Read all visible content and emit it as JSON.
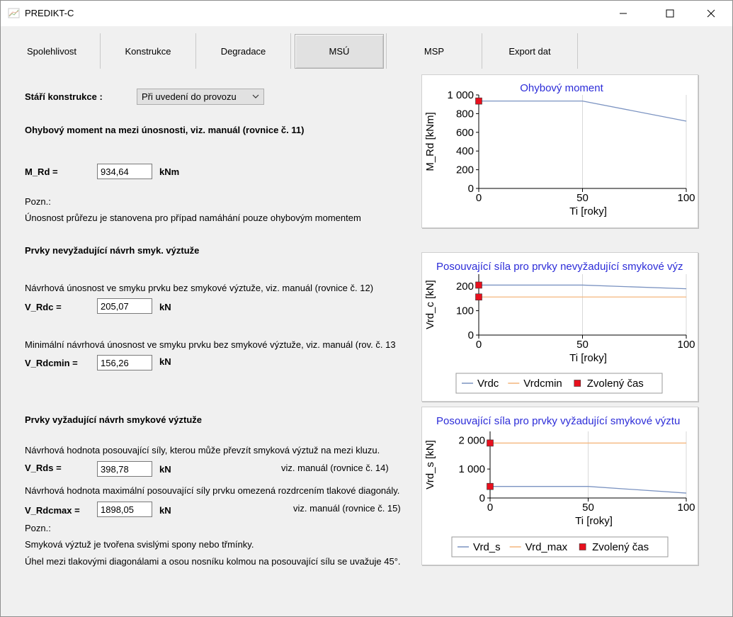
{
  "window": {
    "title": "PREDIKT-C",
    "minimize": "—",
    "maximize": "☐",
    "close": "✕"
  },
  "tabs": [
    "Spolehlivost",
    "Konstrukce",
    "Degradace",
    "MSÚ",
    "MSP",
    "Export dat"
  ],
  "active_tab": "MSÚ",
  "age": {
    "label": "Stáří konstrukce :",
    "value": "Při uvedení do provozu"
  },
  "bending": {
    "heading": "Ohybový moment na mezi únosnosti, viz. manuál (rovnice č. 11)",
    "m_rd_label": "M_Rd =",
    "m_rd_value": "934,64",
    "m_rd_unit": "kNm",
    "note_title": "Pozn.:",
    "note": "Únosnost průřezu je stanovena pro případ namáhání pouze ohybovým momentem"
  },
  "no_shear": {
    "heading": "Prvky nevyžadující návrh smyk. výztuže",
    "vrdc_desc": "Návrhová únosnost ve smyku prvku bez smykové výztuže, viz. manuál (rovnice č. 12)",
    "vrdc_label": "V_Rdc =",
    "vrdc_value": "205,07",
    "vrdc_unit": "kN",
    "vrdcmin_desc": "Minimální návrhová únosnost ve smyku prvku bez smykové výztuže, viz. manuál (rov. č. 13",
    "vrdcmin_label": "V_Rdcmin =",
    "vrdcmin_value": "156,26",
    "vrdcmin_unit": "kN"
  },
  "shear": {
    "heading": "Prvky vyžadující návrh smykové výztuže",
    "vrds_desc": "Návrhová hodnota posouvající síly, kterou může převzít smyková výztuž na mezi kluzu.",
    "vrds_label": "V_Rds =",
    "vrds_value": "398,78",
    "vrds_unit": "kN",
    "vrds_ref": "viz. manuál (rovnice č. 14)",
    "vrdmax_desc": "Návrhová hodnota maximální posouvající síly prvku omezená rozdrcením tlakové diagonály.",
    "vrdmax_label": "V_Rdcmax =",
    "vrdmax_value": "1898,05",
    "vrdmax_unit": "kN",
    "vrdmax_ref": "viz. manuál (rovnice č. 15)",
    "note_title": "Pozn.:",
    "note1": "Smyková výztuž je tvořena svislými spony nebo třmínky.",
    "note2": "Úhel mezi tlakovými diagonálami a osou nosníku kolmou na posouvající sílu se uvažuje 45°."
  },
  "colors": {
    "series_blue": "#7b93c1",
    "series_orange": "#f4b67d",
    "marker_red": "#e8101e",
    "title_blue": "#2c2cd8"
  },
  "chart_data": [
    {
      "type": "line",
      "title": "Ohybový moment",
      "xlabel": "Ti [roky]",
      "ylabel": "M_Rd [kNm]",
      "xlim": [
        0,
        100
      ],
      "ylim": [
        0,
        1000
      ],
      "xticks": [
        "0",
        "50",
        "100"
      ],
      "yticks": [
        "0",
        "200",
        "400",
        "600",
        "800",
        "1 000"
      ],
      "series": [
        {
          "name": "",
          "x": [
            0,
            50,
            100
          ],
          "y": [
            934.64,
            934.64,
            720
          ]
        }
      ],
      "markers": [
        {
          "x": 0,
          "y": 934.64
        }
      ],
      "legend": []
    },
    {
      "type": "line",
      "title": "Posouvající síla pro prvky nevyžadující smykové výz",
      "xlabel": "Ti [roky]",
      "ylabel": "Vrd_c [kN]",
      "xlim": [
        0,
        100
      ],
      "ylim": [
        0,
        250
      ],
      "xticks": [
        "0",
        "50",
        "100"
      ],
      "yticks": [
        "0",
        "100",
        "200"
      ],
      "series": [
        {
          "name": "Vrdc",
          "x": [
            0,
            50,
            100
          ],
          "y": [
            205.07,
            205.07,
            190
          ]
        },
        {
          "name": "Vrdcmin",
          "x": [
            0,
            100
          ],
          "y": [
            156.26,
            156.26
          ]
        }
      ],
      "markers": [
        {
          "x": 0,
          "y": 205.07
        },
        {
          "x": 0,
          "y": 156.26
        }
      ],
      "legend": [
        "Vrdc",
        "Vrdcmin",
        "Zvolený čas"
      ]
    },
    {
      "type": "line",
      "title": "Posouvající síla pro prvky vyžadující smykové výztu",
      "xlabel": "Ti [roky]",
      "ylabel": "Vrd_s [kN]",
      "xlim": [
        0,
        100
      ],
      "ylim": [
        0,
        2300
      ],
      "xticks": [
        "0",
        "50",
        "100"
      ],
      "yticks": [
        "0",
        "1 000",
        "2 000"
      ],
      "series": [
        {
          "name": "Vrd_s",
          "x": [
            0,
            50,
            100
          ],
          "y": [
            398.78,
            398.78,
            170
          ]
        },
        {
          "name": "Vrd_max",
          "x": [
            0,
            100
          ],
          "y": [
            1898.05,
            1898.05
          ]
        }
      ],
      "markers": [
        {
          "x": 0,
          "y": 1898.05
        },
        {
          "x": 0,
          "y": 398.78
        }
      ],
      "legend": [
        "Vrd_s",
        "Vrd_max",
        "Zvolený čas"
      ]
    }
  ]
}
